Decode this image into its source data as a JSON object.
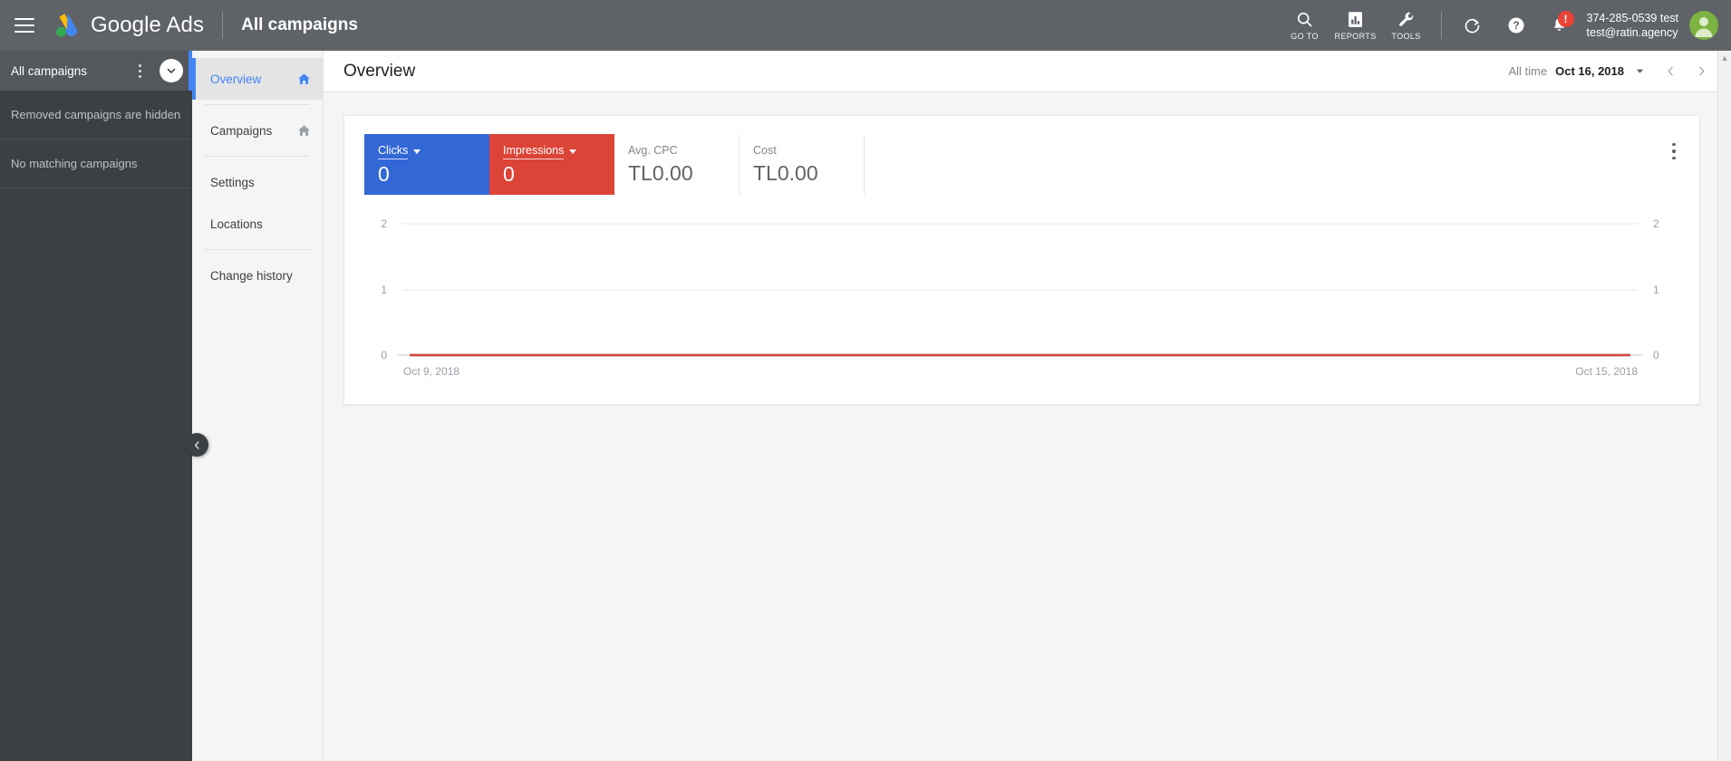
{
  "topbar": {
    "menu_icon": "hamburger-icon",
    "logo_icon": "google-ads-logo",
    "brand": "Google Ads",
    "context_title": "All campaigns",
    "actions": [
      {
        "icon": "search-icon",
        "label": "GO TO"
      },
      {
        "icon": "reports-bar-chart-icon",
        "label": "REPORTS"
      },
      {
        "icon": "wrench-tools-icon",
        "label": "TOOLS"
      }
    ],
    "refresh_icon": "refresh-icon",
    "help_icon": "help-question-icon",
    "notifications_icon": "bell-notification-icon",
    "notification_badge": "!",
    "account_id": "374-285-0539 test",
    "account_email": "test@ratin.agency",
    "avatar_icon": "user-avatar-icon"
  },
  "left_rail": {
    "selected_label": "All campaigns",
    "kebab_icon": "more-vert-icon",
    "expand_icon": "chevron-down-icon",
    "notes": [
      "Removed campaigns are hidden",
      "No matching campaigns"
    ],
    "collapse_icon": "chevron-left-icon"
  },
  "nav": {
    "items": [
      {
        "label": "Overview",
        "active": true,
        "home_icon": "home-icon-blue"
      },
      {
        "label": "Campaigns",
        "active": false,
        "home_icon": "home-icon-grey"
      },
      {
        "label": "Settings",
        "active": false,
        "home_icon": ""
      },
      {
        "label": "Locations",
        "active": false,
        "home_icon": ""
      },
      {
        "label": "Change history",
        "active": false,
        "home_icon": ""
      }
    ]
  },
  "main": {
    "title": "Overview",
    "daterange": {
      "label": "All time",
      "value": "Oct 16, 2018",
      "caret_icon": "dropdown-caret-icon",
      "prev_icon": "chevron-left-icon",
      "next_icon": "chevron-right-icon"
    },
    "card": {
      "kebab_icon": "more-vert-icon",
      "metrics": [
        {
          "label": "Clicks",
          "value": "0",
          "style": "selected-blue",
          "caret": true
        },
        {
          "label": "Impressions",
          "value": "0",
          "style": "selected-red",
          "caret": true
        },
        {
          "label": "Avg. CPC",
          "value": "TL0.00",
          "style": "plain",
          "caret": false
        },
        {
          "label": "Cost",
          "value": "TL0.00",
          "style": "plain",
          "caret": false
        }
      ]
    }
  },
  "colors": {
    "topbar_bg": "#5f6368",
    "rail_bg": "#3c4043",
    "accent_blue": "#4285f4",
    "clicks_card": "#3367d6",
    "impressions_card": "#db4437",
    "chart_line_red": "#db4437",
    "chart_line_blue": "#3367d6",
    "notification_red": "#ea4335",
    "avatar_green": "#7cb342"
  },
  "chart_data": {
    "type": "line",
    "title": "",
    "xlabel": "",
    "ylabel": "",
    "grid": true,
    "legend_position": "none",
    "x_tick_labels": [
      "Oct 9, 2018",
      "Oct 15, 2018"
    ],
    "x_range": [
      "Oct 9, 2018",
      "Oct 15, 2018"
    ],
    "left_axis": {
      "ticks": [
        0,
        1,
        2
      ],
      "ylim": [
        0,
        2
      ]
    },
    "right_axis": {
      "ticks": [
        0,
        1,
        2
      ],
      "ylim": [
        0,
        2
      ]
    },
    "x": [
      "Oct 9, 2018",
      "Oct 10, 2018",
      "Oct 11, 2018",
      "Oct 12, 2018",
      "Oct 13, 2018",
      "Oct 14, 2018",
      "Oct 15, 2018"
    ],
    "series": [
      {
        "name": "Clicks",
        "color": "#3367d6",
        "values": [
          0,
          0,
          0,
          0,
          0,
          0,
          0
        ]
      },
      {
        "name": "Impressions",
        "color": "#db4437",
        "values": [
          0,
          0,
          0,
          0,
          0,
          0,
          0
        ]
      }
    ]
  }
}
